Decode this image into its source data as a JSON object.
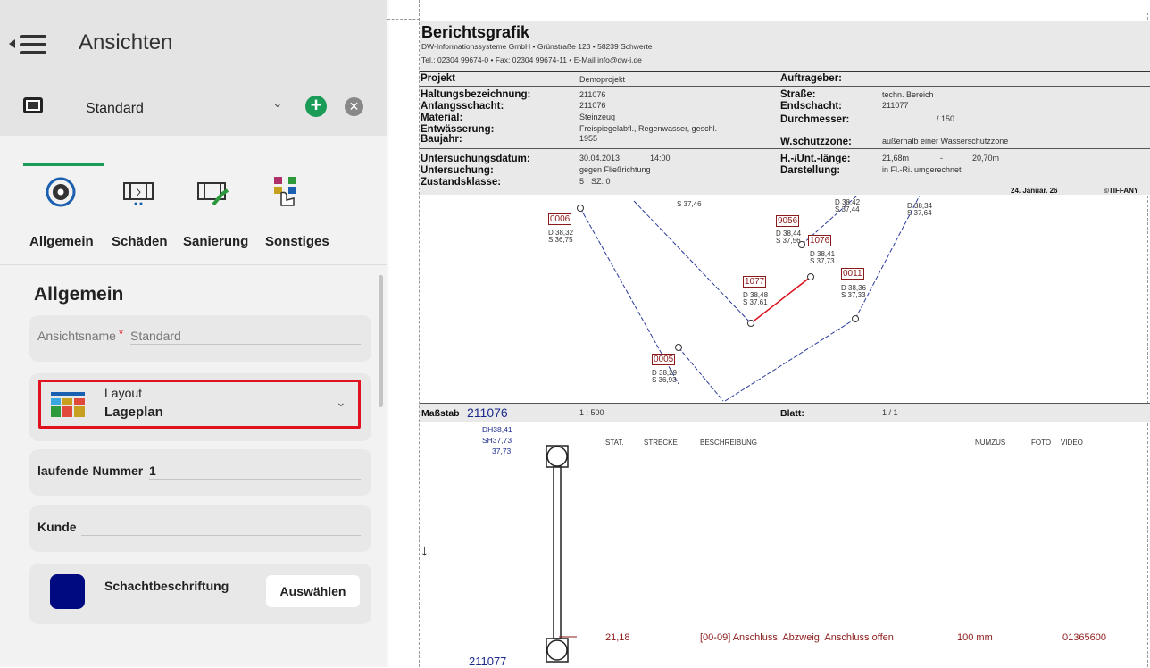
{
  "panel": {
    "title": "Ansichten",
    "view_name": "Standard",
    "tabs": [
      {
        "label": "Allgemein",
        "icon": "gear-refresh-icon"
      },
      {
        "label": "Schäden",
        "icon": "pipe-damage-icon"
      },
      {
        "label": "Sanierung",
        "icon": "pipe-repair-icon"
      },
      {
        "label": "Sonstiges",
        "icon": "abc-hand-icon"
      }
    ],
    "section_title": "Allgemein",
    "ansichtsname_label": "Ansichtsname",
    "required_mark": "*",
    "ansichtsname_value": "Standard",
    "layout_label": "Layout",
    "layout_value": "Lageplan",
    "laufende_label": "laufende Nummer",
    "laufende_value": "1",
    "kunde_label": "Kunde",
    "kunde_value": "",
    "schacht_label": "Schachtbeschriftung",
    "schacht_color": "#000a80",
    "auswaehlen_label": "Auswählen",
    "accent_color": "#1a9b57",
    "highlight_color": "#e0121e"
  },
  "report": {
    "title": "Berichtsgrafik",
    "company_line": "DW-Informationssysteme GmbH • Grünstraße 123 • 58239 Schwerte",
    "contact_line": "Tel.: 02304 99674-0 • Fax: 02304 99674-11 • E-Mail info@dw-i.de",
    "projekt_label": "Projekt",
    "projekt_value": "Demoprojekt",
    "auftraggeber_label": "Auftrageber:",
    "haltung_label": "Haltungsbezeichnung:",
    "haltung_value": "211076",
    "anfang_label": "Anfangsschacht:",
    "anfang_value": "211076",
    "material_label": "Material:",
    "material_value": "Steinzeug",
    "entw_label": "Entwässerung:",
    "entw_value": "Freispiegelabfl., Regenwasser, geschl.",
    "baujahr_label": "Baujahr:",
    "baujahr_value": "1955",
    "strasse_label": "Straße:",
    "strasse_value": "techn. Bereich",
    "end_label": "Endschacht:",
    "end_value": "211077",
    "durch_label": "Durchmesser:",
    "durch_value": "/ 150",
    "wschutz_label": "W.schutzzone:",
    "wschutz_value": "außerhalb einer Wasserschutzzone",
    "unters_datum_label": "Untersuchungsdatum:",
    "unters_datum_value": "30.04.2013",
    "unters_time": "14:00",
    "unters_label": "Untersuchung:",
    "unters_value": "gegen Fließrichtung",
    "zustand_label": "Zustandsklasse:",
    "zustand_value": "5",
    "zustand_sz": "SZ: 0",
    "hlaenge_label": "H.-/Unt.-länge:",
    "hlaenge_value1": "21,68m",
    "hlaenge_dash": "-",
    "hlaenge_value2": "20,70m",
    "darst_label": "Darstellung:",
    "darst_value": "in Fl.-Ri. umgerechnet",
    "date": "24. Januar. 26",
    "user": "©TIFFANY",
    "map": {
      "s_3746": "S 37,46",
      "d_3842": "D 38,42",
      "s_3744": "S 37,44",
      "d_3834": "D 38,34",
      "s_3764": "S 37,64",
      "l0006": "0006",
      "d_3832": "D 38,32",
      "s_3675": "S 36,75",
      "l9056": "9056",
      "d_3844": "D 38,44",
      "s_3756": "S 37,56",
      "l1076": "1076",
      "d_3841": "D 38,41",
      "s_3773": "S 37,73",
      "l1077": "1077",
      "d_3848": "D 38,48",
      "s_3761": "S 37,61",
      "l0011": "0011",
      "d_3836": "D 38,36",
      "s_3733": "S 37,33",
      "l0005": "0005",
      "d_3829": "D 38,29",
      "s_3693": "S 36,93"
    },
    "massstab_label": "Maßstab",
    "massstab_id": "211076",
    "scale": "1 : 500",
    "blatt_label": "Blatt:",
    "blatt_value": "1 / 1",
    "dh": "DH38,41",
    "sh": "SH37,73",
    "h": "37,73",
    "cols": {
      "stat": "STAT.",
      "strecke": "STRECKE",
      "beschreibung": "BESCHREIBUNG",
      "numzus": "NUMZUS",
      "foto": "FOTO",
      "video": "VIDEO"
    },
    "row": {
      "stat": "21,18",
      "desc": "[00-09] Anschluss, Abzweig, Anschluss offen",
      "size": "100 mm",
      "video": "01365600"
    },
    "bottom_id": "211077",
    "arrow": "↓"
  }
}
